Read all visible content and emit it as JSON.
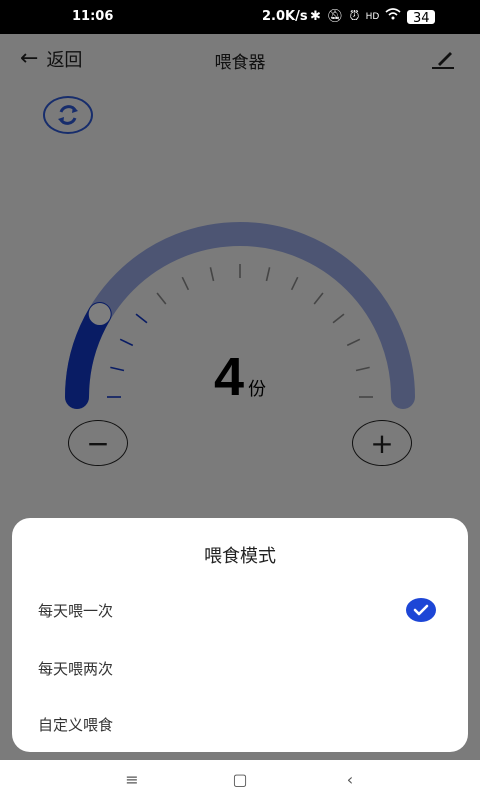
{
  "status_bar": {
    "time": "11:06",
    "net_speed": "2.0K/s",
    "battery": "34",
    "icons": [
      "bluetooth-icon",
      "mute-icon",
      "alarm-icon",
      "hd-icon",
      "wifi-icon",
      "battery-icon"
    ]
  },
  "header": {
    "back_label": "返回",
    "title": "喂食器",
    "edit_icon": "edit-icon"
  },
  "dial": {
    "value": "4",
    "unit": "份",
    "level_fraction": 0.17,
    "minus_label": "−",
    "plus_label": "+"
  },
  "sheet": {
    "title": "喂食模式",
    "options": [
      {
        "label": "每天喂一次",
        "selected": true
      },
      {
        "label": "每天喂两次",
        "selected": false
      },
      {
        "label": "自定义喂食",
        "selected": false
      }
    ]
  },
  "nav": {
    "menu_icon": "menu-icon",
    "home_icon": "home-icon",
    "back_icon": "back-icon"
  },
  "colors": {
    "accent": "#1d46d6",
    "arc_track": "#9aabe6",
    "arc_fill": "#1339c8"
  }
}
